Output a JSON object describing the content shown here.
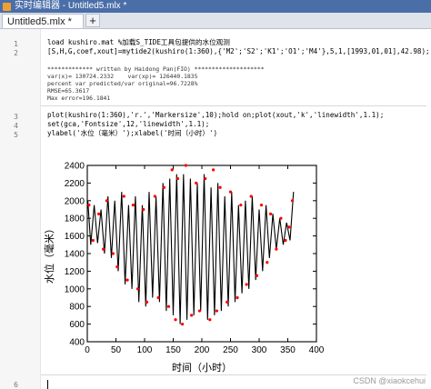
{
  "window": {
    "title": "实时编辑器 - Untitled5.mlx *"
  },
  "tabs": [
    {
      "label": "Untitled5.mlx *",
      "close": "×"
    }
  ],
  "tab_add": "+",
  "editor": {
    "line_numbers": [
      "1",
      "2",
      "3",
      "4",
      "5"
    ],
    "cursor_line_number": "6",
    "section1_code": [
      "load kushiro.mat %加载S_TIDE工具包提供的水位观测",
      "[S,H,G,coef,xout]=mytide2(kushiro(1:360),{'M2';'S2';'K1';'O1';'M4'},5,1,[1993,01,01],42.98);"
    ],
    "section1_output": [
      "************* written by Haidong Pan(FIO) ********************",
      "var(x)= 130724.2332    var(xp)= 126440.1835",
      "percent var predicted/var original=96.7228%",
      "RMSE=65.3617",
      "Max error=196.1841"
    ],
    "section2_code": [
      "plot(kushiro(1:360),'r.','Markersize',10);hold on;plot(xout,'k','linewidth',1.1);",
      "set(gca,'Fontsize',12,'linewidth',1.1);",
      "ylabel('水位（毫米）');xlabel('时间（小时）')"
    ]
  },
  "watermark": "CSDN @xiaokcehui",
  "colors": {
    "titlebar": "#4a6ea8",
    "model_line": "#000000",
    "observations": "#ff0000"
  },
  "chart_data": {
    "type": "line",
    "xlabel": "时间（小时）",
    "ylabel": "水位（毫米）",
    "xlim": [
      0,
      400
    ],
    "ylim": [
      400,
      2400
    ],
    "xticks": [
      "0",
      "50",
      "100",
      "150",
      "200",
      "250",
      "300",
      "350",
      "400"
    ],
    "yticks": [
      "400",
      "600",
      "800",
      "1000",
      "1200",
      "1400",
      "1600",
      "1800",
      "2000",
      "2200",
      "2400"
    ],
    "grid": false,
    "series": [
      {
        "style": "black line",
        "x": [
          1,
          6,
          12,
          18,
          24,
          30,
          36,
          42,
          48,
          54,
          60,
          66,
          72,
          78,
          84,
          90,
          96,
          102,
          108,
          114,
          120,
          126,
          132,
          138,
          144,
          150,
          156,
          162,
          168,
          174,
          180,
          186,
          192,
          198,
          204,
          210,
          216,
          222,
          228,
          234,
          240,
          246,
          252,
          258,
          264,
          270,
          276,
          282,
          288,
          294,
          300,
          306,
          312,
          318,
          324,
          330,
          336,
          342,
          348,
          354,
          360
        ],
        "y": [
          2000,
          1500,
          1950,
          1520,
          1900,
          1400,
          2050,
          1350,
          2000,
          1200,
          2100,
          1050,
          1950,
          1000,
          2050,
          850,
          1950,
          800,
          2100,
          900,
          2050,
          850,
          2200,
          750,
          2250,
          700,
          2300,
          600,
          2300,
          650,
          2250,
          700,
          2200,
          750,
          2300,
          650,
          2150,
          700,
          2200,
          750,
          2050,
          800,
          2100,
          850,
          1950,
          950,
          2000,
          1000,
          2050,
          1100,
          1900,
          1200,
          1950,
          1350,
          1850,
          1450,
          1800,
          1500,
          1750,
          1550,
          2100
        ]
      },
      {
        "style": "red dots",
        "x": [
          3,
          10,
          20,
          28,
          34,
          45,
          52,
          64,
          70,
          80,
          88,
          98,
          104,
          118,
          124,
          134,
          142,
          148,
          154,
          158,
          166,
          172,
          182,
          190,
          196,
          206,
          214,
          220,
          226,
          232,
          244,
          250,
          262,
          268,
          278,
          286,
          296,
          304,
          314,
          320,
          330,
          338,
          346,
          352,
          358
        ],
        "y": [
          1950,
          1550,
          1850,
          1450,
          2000,
          1400,
          1250,
          2050,
          1100,
          1950,
          1000,
          1900,
          850,
          2050,
          900,
          2150,
          800,
          2350,
          650,
          2250,
          600,
          2400,
          700,
          2200,
          750,
          2250,
          650,
          2350,
          750,
          2150,
          850,
          2100,
          900,
          1950,
          1050,
          2050,
          1150,
          1950,
          1300,
          1850,
          1450,
          1800,
          1550,
          1700,
          2000
        ]
      }
    ]
  }
}
